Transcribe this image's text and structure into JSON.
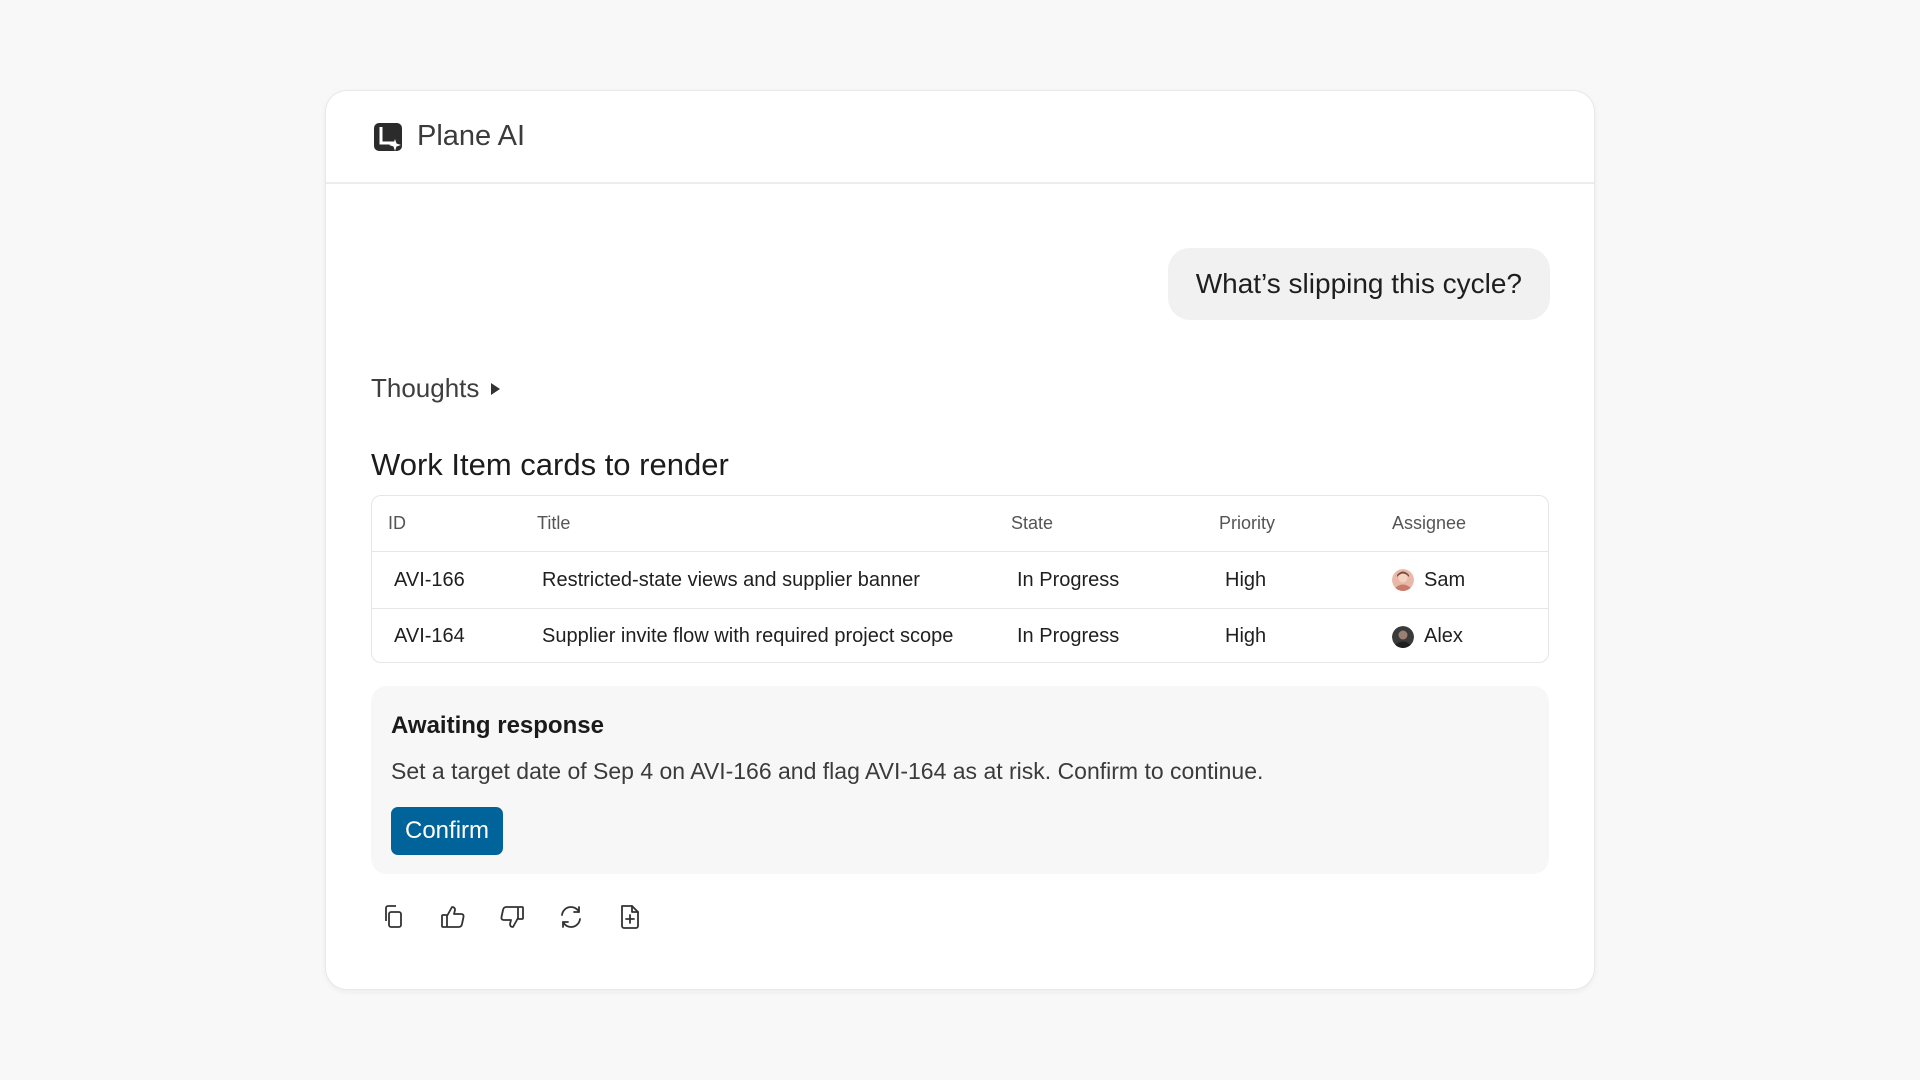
{
  "app": {
    "title": "Plane AI"
  },
  "chat": {
    "user_message": "What’s slipping this cycle?",
    "thoughts_label": "Thoughts"
  },
  "work_items": {
    "title": "Work Item cards to render",
    "columns": [
      "ID",
      "Title",
      "State",
      "Priority",
      "Assignee"
    ],
    "rows": [
      {
        "id": "AVI-166",
        "title": "Restricted-state views and supplier banner",
        "state": "In Progress",
        "priority": "High",
        "assignee": "Sam"
      },
      {
        "id": "AVI-164",
        "title": "Supplier invite flow with required project scope",
        "state": "In Progress",
        "priority": "High",
        "assignee": "Alex"
      }
    ]
  },
  "awaiting": {
    "title": "Awaiting response",
    "text": "Set a target date of Sep 4 on AVI-166 and flag AVI-164 as at risk. Confirm to continue.",
    "confirm_label": "Confirm"
  },
  "actions": [
    "copy-icon",
    "thumbs-up-icon",
    "thumbs-down-icon",
    "regenerate-icon",
    "add-to-page-icon"
  ],
  "colors": {
    "accent": "#006399",
    "bubble": "#f1f1f1",
    "panel": "#f7f7f7"
  }
}
